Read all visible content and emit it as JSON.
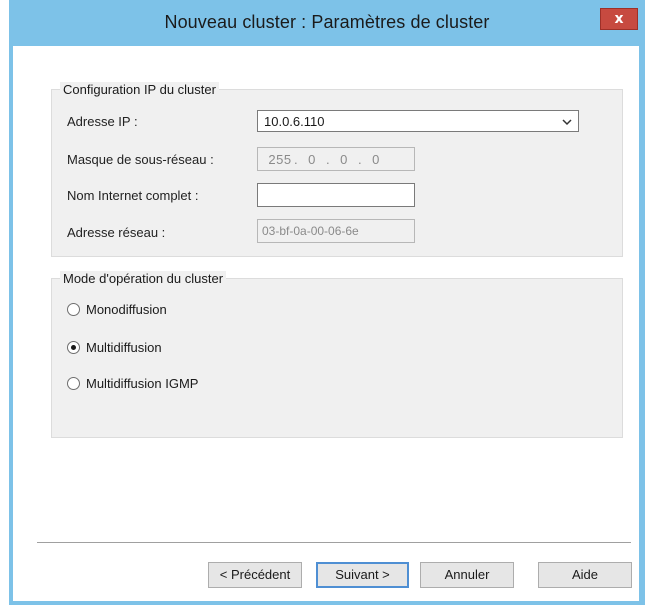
{
  "window": {
    "title": "Nouveau cluster : Paramètres de cluster",
    "close_glyph": "x",
    "accent_color": "#7dc2e8"
  },
  "ip_config": {
    "legend": "Configuration IP du cluster",
    "ip_address_label": "Adresse IP :",
    "ip_address_value": "10.0.6.110",
    "subnet_mask_label": "Masque de sous-réseau :",
    "subnet_mask_octets": [
      "255",
      "0",
      "0",
      "0"
    ],
    "fqdn_label": "Nom Internet complet :",
    "fqdn_value": "",
    "network_address_label": "Adresse réseau :",
    "network_address_value": "03-bf-0a-00-06-6e"
  },
  "operation_mode": {
    "legend": "Mode d'opération du cluster",
    "options": [
      {
        "label": "Monodiffusion",
        "checked": false
      },
      {
        "label": "Multidiffusion",
        "checked": true
      },
      {
        "label": "Multidiffusion IGMP",
        "checked": false
      }
    ]
  },
  "buttons": {
    "previous": "< Précédent",
    "next": "Suivant >",
    "cancel": "Annuler",
    "help": "Aide"
  },
  "icons": {
    "combo_arrow": "chevron-down-icon",
    "close": "close-icon"
  }
}
